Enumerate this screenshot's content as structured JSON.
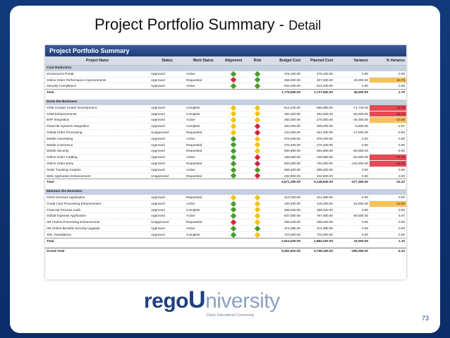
{
  "slide": {
    "title": "Project Portfolio Summary",
    "separator": " - ",
    "subtitle": "Detail",
    "page_number": "73"
  },
  "report": {
    "header": "Project Portfolio Summary",
    "columns": [
      "Project Name",
      "Status",
      "Work Status",
      "Alignment",
      "Risk",
      "Budget Cost",
      "Planned Cost",
      "Variance",
      "% Variance"
    ],
    "groups": [
      {
        "name": "Cost Reduction",
        "rows": [
          [
            "eCommerce Portal",
            "Approved",
            "Active",
            "green",
            "green",
            "476,100.00",
            "476,100.00",
            "0.00",
            "0.00",
            ""
          ],
          [
            "Online Order Performance Improvements",
            "Approved",
            "Requested",
            "red",
            "green",
            "455,000.00",
            "407,000.00",
            "49,000.00",
            "10.75",
            "warn"
          ],
          [
            "Security Compliance",
            "Approved",
            "Active",
            "green",
            "green",
            "844,400.00",
            "844,400.00",
            "0.00",
            "0.00",
            ""
          ]
        ],
        "total": [
          "Total",
          "1,775,500.00",
          "1,727,500.00",
          "49,000.00",
          "2.76"
        ]
      },
      {
        "name": "Grow the Business",
        "rows": [
          [
            "CRM Contact Center Development",
            "Approved",
            "Complete",
            "yellow",
            "yellow",
            "514,240.00",
            "585,980.00",
            "-71,740.00",
            "-13.95",
            "bad"
          ],
          [
            "CRM Enhancements",
            "Approved",
            "Complete",
            "yellow",
            "yellow",
            "250,400.00",
            "482,930.00",
            "-60,000.00",
            "-34.75",
            "bad"
          ],
          [
            "ERP Integration",
            "Approved",
            "Active",
            "yellow",
            "yellow",
            "250,000.00",
            "275,000.00",
            "-25,000.00",
            "-10.00",
            "warn"
          ],
          [
            "Financial Systems Integration",
            "Approved",
            "Complete",
            "yellow",
            "red",
            "300,000.00",
            "305,000.00",
            "-5,000.00",
            "-1.67",
            ""
          ],
          [
            "Global Order Processing",
            "Unapproved",
            "Requested",
            "yellow",
            "red",
            "434,000.00",
            "451,000.00",
            "-17,000.00",
            "-3.94",
            ""
          ],
          [
            "Mobile Advertising",
            "Approved",
            "Active",
            "green",
            "yellow",
            "378,400.00",
            "378,400.00",
            "0.00",
            "0.00",
            ""
          ],
          [
            "Mobile Commerce",
            "Approved",
            "Requested",
            "green",
            "yellow",
            "270,400.00",
            "270,400.00",
            "0.00",
            "0.00",
            ""
          ],
          [
            "Mobile Security",
            "Approved",
            "Requested",
            "green",
            "yellow",
            "884,900.00",
            "934,900.00",
            "-50,000.00",
            "-5.65",
            ""
          ],
          [
            "Online Order Catalog",
            "Approved",
            "Active",
            "green",
            "red",
            "189,650.00",
            "239,650.00",
            "-50,000.00",
            "-26.36",
            "bad"
          ],
          [
            "Online Order Entry",
            "Approved",
            "Requested",
            "green",
            "red",
            "600,000.00",
            "734,000.00",
            "-134,000.00",
            "-22.33",
            "bad"
          ],
          [
            "Order Tracking Analysis",
            "Approved",
            "Active",
            "green",
            "green",
            "258,400.00",
            "258,400.00",
            "0.00",
            "0.00",
            ""
          ],
          [
            "Web Application Enhancement",
            "Unapproved",
            "Requested",
            "green",
            "red",
            "232,900.00",
            "232,900.00",
            "0.00",
            "0.00",
            ""
          ]
        ],
        "total": [
          "Total",
          "4,671,290.00",
          "5,148,640.00",
          "-477,350.00",
          "-10.22"
        ]
      },
      {
        "name": "Maintain the Business",
        "rows": [
          [
            "Client Services Application",
            "Approved",
            "Requested",
            "yellow",
            "yellow",
            "214,000.00",
            "214,000.00",
            "0.00",
            "0.00",
            ""
          ],
          [
            "Credit Card Processing Enhancement",
            "Approved",
            "Active",
            "green",
            "yellow",
            "130,400.00",
            "148,400.00",
            "-18,000.00",
            "-13.80",
            "warn"
          ],
          [
            "Financial Process Audit",
            "Approved",
            "Complete",
            "green",
            "yellow",
            "389,040.00",
            "389,040.00",
            "0.00",
            "0.00",
            ""
          ],
          [
            "Global Expense Application",
            "Approved",
            "Active",
            "green",
            "yellow",
            "837,000.00",
            "787,000.00",
            "50,000.00",
            "5.97",
            ""
          ],
          [
            "HR Claims Processing Enhancement",
            "Unapproved",
            "Requested",
            "red",
            "yellow",
            "258,400.00",
            "258,400.00",
            "0.00",
            "0.00",
            ""
          ],
          [
            "HR Online Benefits Security Upgrade",
            "Approved",
            "Active",
            "green",
            "green",
            "374,380.00",
            "374,380.00",
            "0.00",
            "0.00",
            ""
          ],
          [
            "XRL Translations",
            "Approved",
            "Complete",
            "green",
            "yellow",
            "710,000.00",
            "710,000.00",
            "0.00",
            "0.00",
            ""
          ]
        ],
        "total": [
          "Total",
          "2,914,020.00",
          "2,882,020.00",
          "32,000.00",
          "1.10"
        ]
      }
    ],
    "grand_total": [
      "Grand Total",
      "9,361,810.00",
      "9,758,160.00",
      "-396,350.00",
      "-4.23"
    ]
  },
  "logo": {
    "rego": "rego",
    "u": "U",
    "niversity": "niversity",
    "tagline": "Clarity Educational Community"
  },
  "colors": {
    "frame": "#0d2f6b",
    "report_header": "#1f3d7a",
    "green": "#4a9a2c",
    "yellow": "#f0c419",
    "red": "#d0243e",
    "warn": "#f6c25a",
    "bad": "#e34a55"
  }
}
